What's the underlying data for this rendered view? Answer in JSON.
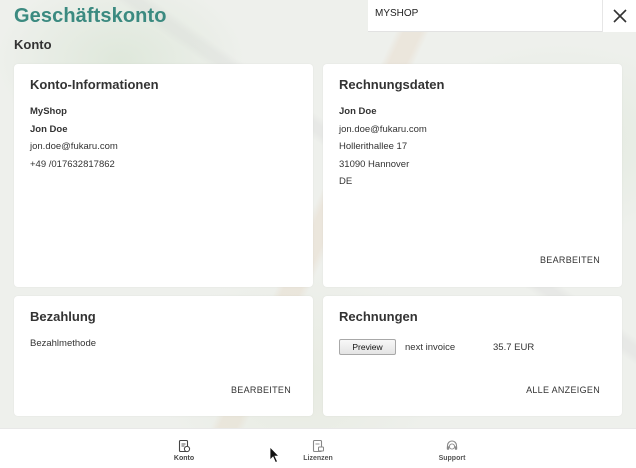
{
  "header": {
    "title": "Geschäftskonto",
    "section": "Konto",
    "shop_name": "MYSHOP"
  },
  "cards": {
    "account_info": {
      "title": "Konto-Informationen",
      "lines": [
        "MyShop",
        "Jon Doe",
        "jon.doe@fukaru.com",
        "+49 /017632817862"
      ]
    },
    "billing": {
      "title": "Rechnungsdaten",
      "lines": [
        "Jon Doe",
        "jon.doe@fukaru.com",
        "Hollerithallee 17",
        "31090 Hannover",
        "DE"
      ],
      "edit_label": "BEARBEITEN"
    },
    "payment": {
      "title": "Bezahlung",
      "method_label": "Bezahlmethode",
      "edit_label": "BEARBEITEN"
    },
    "invoices": {
      "title": "Rechnungen",
      "preview_label": "Preview",
      "next_invoice_label": "next invoice",
      "next_invoice_amount": "35.7 EUR",
      "show_all_label": "ALLE ANZEIGEN"
    }
  },
  "bottom_nav": [
    {
      "label": "Konto",
      "icon": "account-doc-icon"
    },
    {
      "label": "Lizenzen",
      "icon": "license-doc-icon"
    },
    {
      "label": "Support",
      "icon": "support-headset-icon"
    }
  ]
}
